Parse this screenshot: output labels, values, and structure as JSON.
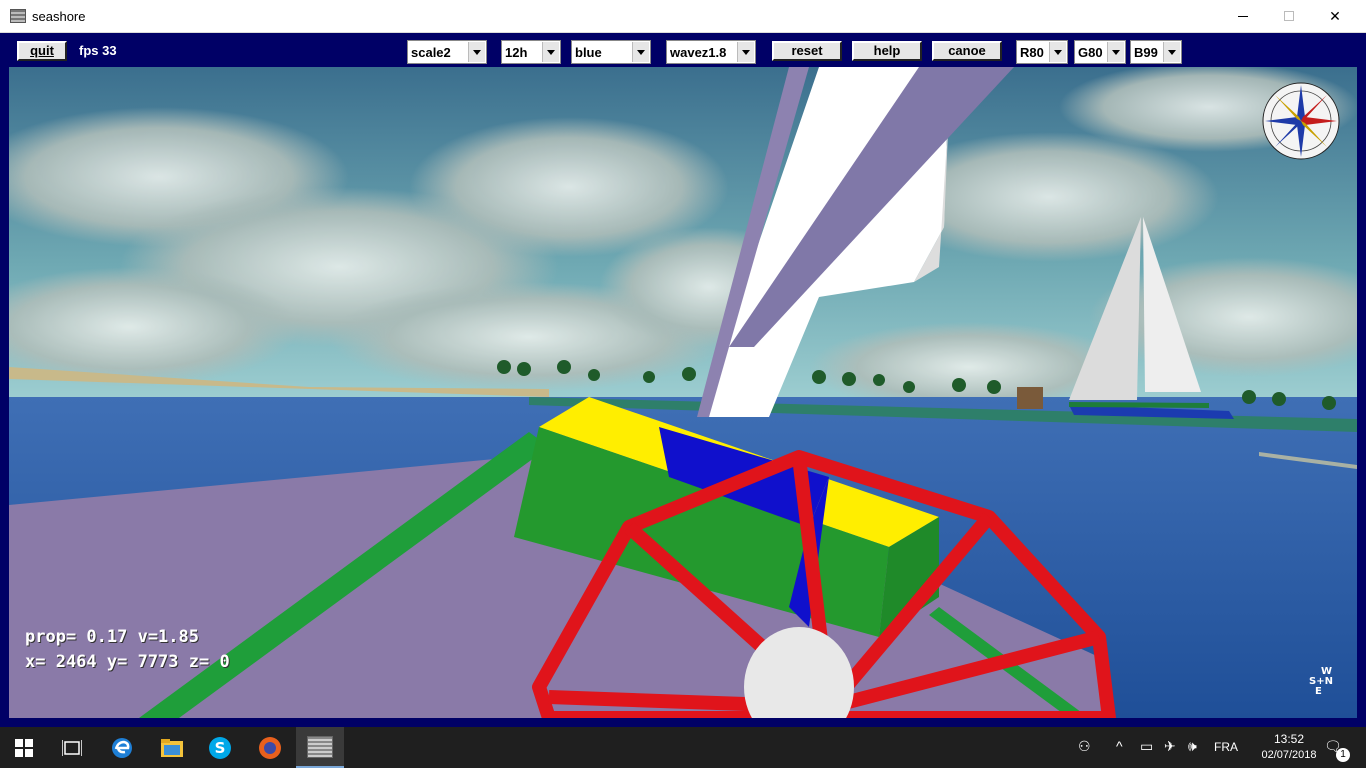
{
  "window": {
    "title": "seashore",
    "minimize_icon": "minimize-icon",
    "maximize_icon": "maximize-icon",
    "close_icon": "close-icon"
  },
  "toolbar": {
    "quit_label": "quit",
    "fps": "fps 33",
    "scale": "scale2",
    "time": "12h",
    "color": "blue",
    "waves": "wavez1.8",
    "reset_label": "reset",
    "help_label": "help",
    "canoe_label": "canoe",
    "red": "R80",
    "green": "G80",
    "blue": "B99"
  },
  "hud": {
    "line1": "prop= 0.17  v=1.85",
    "line2": "x= 2464 y= 7773 z= 0"
  },
  "mini_compass": {
    "w": "W",
    "s": "S",
    "n": "N",
    "e": "E"
  },
  "taskbar": {
    "language": "FRA",
    "time": "13:52",
    "date": "02/07/2018",
    "notification_count": "1"
  }
}
